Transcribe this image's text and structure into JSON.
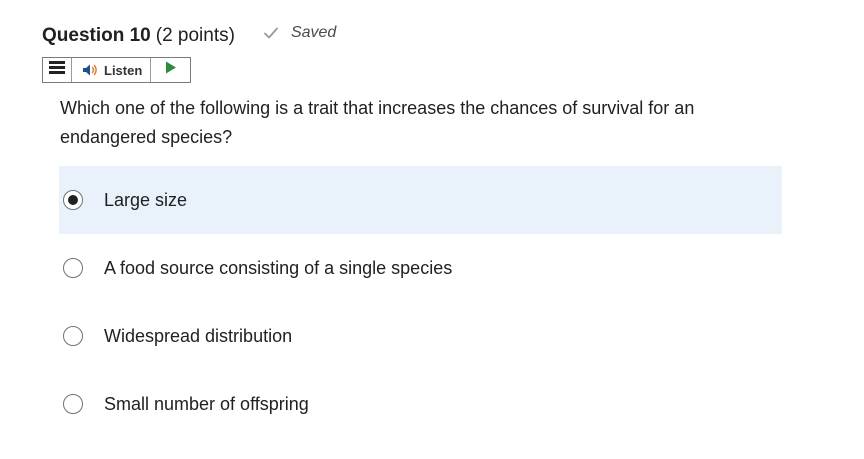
{
  "question": {
    "title": "Question 10",
    "points": "(2 points)",
    "saved_label": "Saved",
    "text": "Which one of the following is a trait that increases the chances of survival for an endangered species?"
  },
  "toolbar": {
    "listen_label": "Listen"
  },
  "options": [
    {
      "label": "Large size",
      "selected": true
    },
    {
      "label": "A food source consisting of a single species",
      "selected": false
    },
    {
      "label": "Widespread distribution",
      "selected": false
    },
    {
      "label": "Small number of offspring",
      "selected": false
    }
  ],
  "colors": {
    "selected_background": "#e9f2fb",
    "play_icon": "#2e8b3a",
    "speaker_icon": "#1f4e8c",
    "check_icon": "#9a9a9a"
  }
}
